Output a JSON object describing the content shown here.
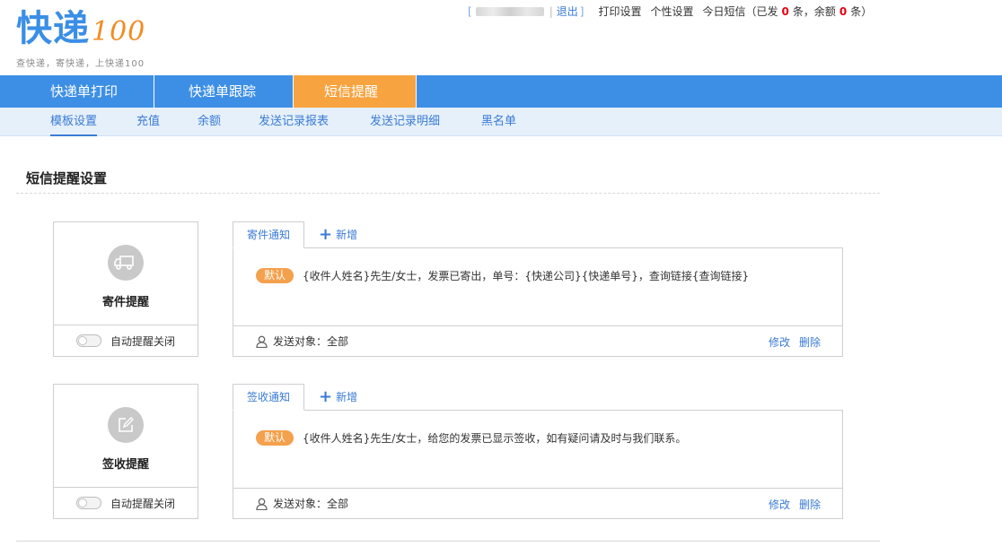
{
  "logo": {
    "main": "快递",
    "suffix": "100",
    "slogan": "查快递，寄快递，上快递100"
  },
  "topbar": {
    "open_bracket": "[",
    "separator": "|",
    "logout": "退出",
    "close_bracket": "]",
    "print_settings": "打印设置",
    "personal_settings": "个性设置",
    "sms_today_prefix": "今日短信（已发",
    "sent_count": "0",
    "sms_mid": "条，余额",
    "balance_count": "0",
    "sms_suffix": "条）"
  },
  "main_nav": [
    {
      "label": "快递单打印"
    },
    {
      "label": "快递单跟踪"
    },
    {
      "label": "短信提醒",
      "active": true
    }
  ],
  "sub_nav": [
    {
      "label": "模板设置",
      "active": true
    },
    {
      "label": "充值"
    },
    {
      "label": "余额"
    },
    {
      "label": "发送记录报表"
    },
    {
      "label": "发送记录明细"
    },
    {
      "label": "黑名单"
    }
  ],
  "section": {
    "title": "短信提醒设置"
  },
  "reminders": [
    {
      "title": "寄件提醒",
      "icon": "truck-icon",
      "toggle_label": "自动提醒关闭",
      "tab_label": "寄件通知",
      "add_label": "新增",
      "badge": "默认",
      "template": "{收件人姓名}先生/女士，发票已寄出，单号：{快递公司}{快递单号}，查询链接{查询链接}",
      "target_label": "发送对象：全部",
      "edit_label": "修改",
      "delete_label": "删除"
    },
    {
      "title": "签收提醒",
      "icon": "edit-icon",
      "toggle_label": "自动提醒关闭",
      "tab_label": "签收通知",
      "add_label": "新增",
      "badge": "默认",
      "template": "{收件人姓名}先生/女士，给您的发票已显示签收，如有疑问请及时与我们联系。",
      "target_label": "发送对象：全部",
      "edit_label": "修改",
      "delete_label": "删除"
    }
  ],
  "colors": {
    "primary_blue": "#3d8fe6",
    "active_orange": "#f7a340",
    "badge_orange": "#f4a04c",
    "subnav_bg": "#e6f0fb",
    "count_red": "#e60012"
  }
}
